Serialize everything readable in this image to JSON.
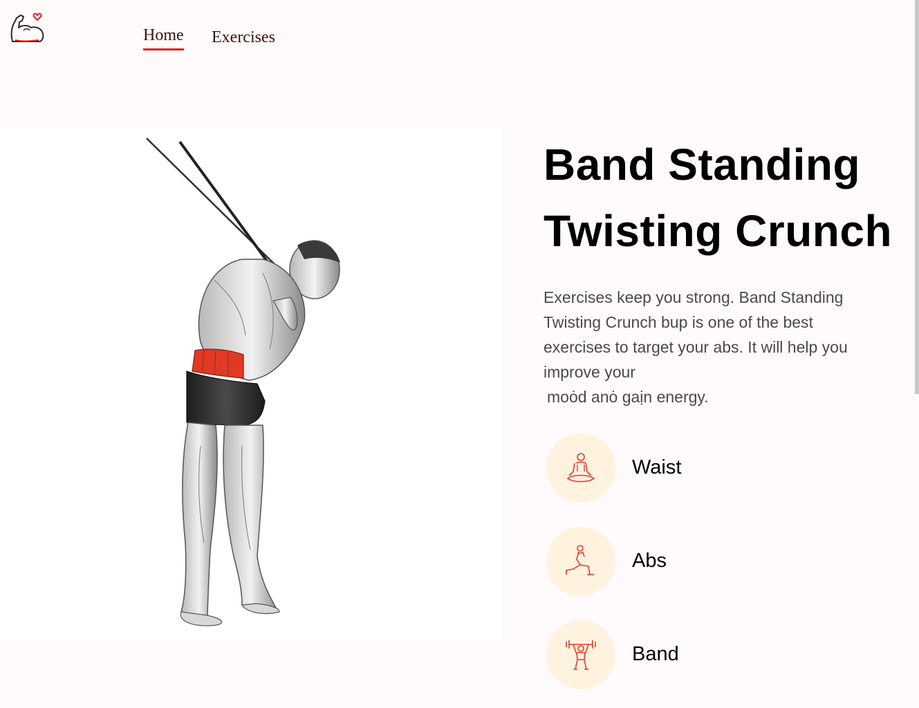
{
  "nav": {
    "logo_icon": "flexed-arm-heart-icon",
    "links": [
      {
        "label": "Home",
        "active": true
      },
      {
        "label": "Exercises",
        "active": false
      }
    ]
  },
  "exercise": {
    "title_line1": "Band Standing",
    "title_line2": "Twisting Crunch",
    "description_main": "Exercises keep you strong. Band Standing Twisting Crunch bup is one of the best exercises to target your abs. It will help you improve your",
    "description_tail": "moȯd anȯ gaịn energy.",
    "details": [
      {
        "icon": "meditation-icon",
        "label": "Waist"
      },
      {
        "icon": "lunge-stretch-icon",
        "label": "Abs"
      },
      {
        "icon": "weightlifter-icon",
        "label": "Band"
      }
    ]
  },
  "colors": {
    "accent": "#e0201e",
    "icon_circle": "#fff2df",
    "background": "#fffafb"
  }
}
